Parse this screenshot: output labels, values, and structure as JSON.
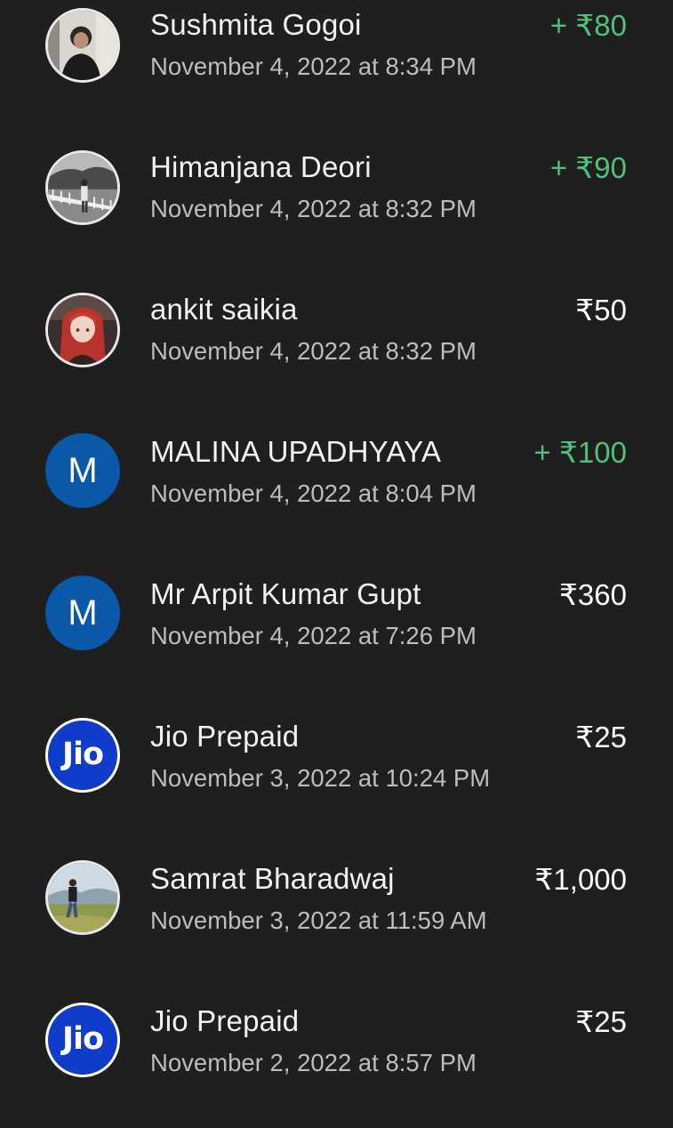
{
  "colors": {
    "background": "#1f1f1f",
    "name_text": "#f2f2f2",
    "date_text": "#bdbdbd",
    "credit_amount": "#4dc27a",
    "debit_amount": "#ffffff",
    "letter_avatar_bg": "#0b57a8",
    "jio_avatar_bg": "#0f3cc9"
  },
  "transactions": [
    {
      "name": "Sushmita Gogoi",
      "date": "November 4, 2022 at 8:34 PM",
      "amount": "+ ₹80",
      "avatar": "photo-person-icon"
    },
    {
      "name": "Himanjana Deori",
      "date": "November 4, 2022 at 8:32 PM",
      "amount": "+ ₹90",
      "avatar": "photo-bridge-icon"
    },
    {
      "name": "ankit saikia",
      "date": "November 4, 2022 at 8:32 PM",
      "amount": "₹50",
      "avatar": "photo-anime-icon"
    },
    {
      "name": "MALINA  UPADHYAYA",
      "date": "November 4, 2022 at 8:04 PM",
      "amount": "+ ₹100",
      "avatar_letter": "M"
    },
    {
      "name": "Mr  Arpit Kumar Gupt",
      "date": "November 4, 2022 at 7:26 PM",
      "amount": "₹360",
      "avatar_letter": "M"
    },
    {
      "name": "Jio Prepaid",
      "date": "November 3, 2022 at 10:24 PM",
      "amount": "₹25",
      "avatar_logo": "Jio"
    },
    {
      "name": "Samrat Bharadwaj",
      "date": "November 3, 2022 at 11:59 AM",
      "amount": "₹1,000",
      "avatar": "photo-field-icon"
    },
    {
      "name": "Jio Prepaid",
      "date": "November 2, 2022 at 8:57 PM",
      "amount": "₹25",
      "avatar_logo": "Jio"
    }
  ]
}
